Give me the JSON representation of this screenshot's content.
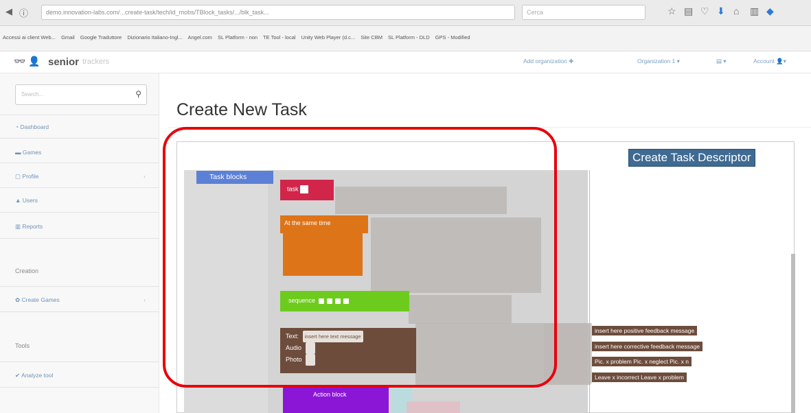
{
  "browser": {
    "url": "demo.innovation-labs.com/...create-task/tech/id_mobs/TBlock_tasks/.../blk_task...",
    "search_placeholder": "Cerca",
    "bookmarks": [
      "Accessi ai client Web...",
      "Gmail",
      "Google Traduttore",
      "Dizionario Italiano-Ingl...",
      "Angel.com",
      "SL Platform - non",
      "TE Tool - local",
      "Unity Web Player (d.c...",
      "Site CBM",
      "SL Platform - DLD",
      "GPS - Modified"
    ]
  },
  "app": {
    "brand": "senior",
    "brand_sub": "trackers",
    "header_links": [
      "Add organization",
      "Organization 1",
      "",
      "Account"
    ]
  },
  "sidebar": {
    "search_placeholder": "Search...",
    "items": [
      {
        "label": "Dashboard",
        "icon": "dashboard-icon"
      },
      {
        "label": "Games",
        "icon": "games-icon"
      },
      {
        "label": "Profile",
        "icon": "profile-icon"
      },
      {
        "label": "Users",
        "icon": "users-icon"
      },
      {
        "label": "Reports",
        "icon": "reports-icon"
      }
    ],
    "creation_heading": "Creation",
    "creation_items": [
      {
        "label": "Create Games",
        "icon": "gear-icon"
      }
    ],
    "tools_heading": "Tools",
    "tools_items": [
      {
        "label": "Analyze tool",
        "icon": "check-icon"
      }
    ]
  },
  "main": {
    "title": "Create New Task",
    "descriptor_button": "Create Task Descriptor",
    "category_tab": "Task blocks",
    "blocks": {
      "task": "task",
      "parallel": "At the same time",
      "sequence": "sequence",
      "feedback_text_label": "Text",
      "feedback_text_value": "insert here text message",
      "feedback_audio_label": "Audio",
      "feedback_photo_label": "Photo",
      "action_block": "Action block"
    },
    "right_rows": [
      "insert here positive feedback message",
      "insert here corrective feedback message",
      "Pic. x problem   Pic. x neglect   Pic. x n",
      "Leave x incorrect   Leave x problem"
    ]
  },
  "colors": {
    "task": "#d1254a",
    "parallel": "#dd7418",
    "sequence": "#6dcb1d",
    "feedback": "#6d4c3c",
    "action": "#8b16d6",
    "highlight": "#e8000b",
    "descriptor": "#3f6a92",
    "category_tab": "#5b80d6"
  }
}
